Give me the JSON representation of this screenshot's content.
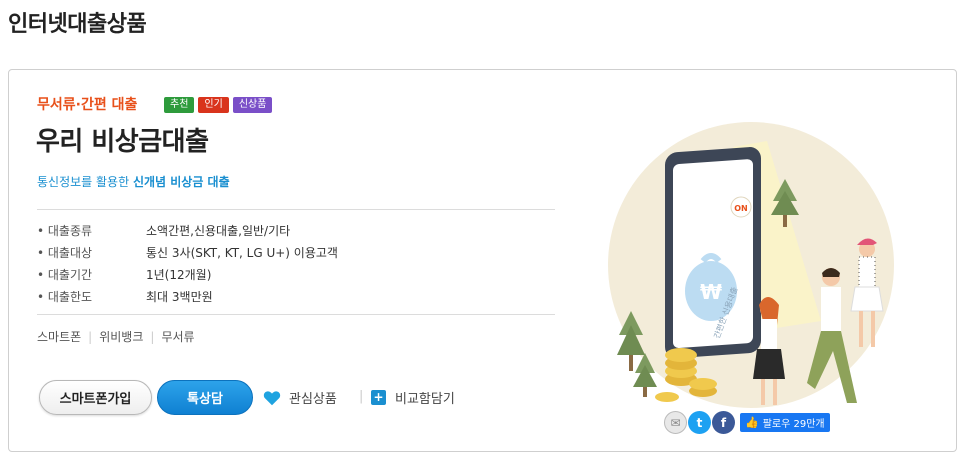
{
  "page": {
    "title": "인터넷대출상품"
  },
  "product": {
    "category": "무서류·간편 대출",
    "badges": [
      {
        "label": "추천",
        "color": "#2e9b3c"
      },
      {
        "label": "인기",
        "color": "#d9341c"
      },
      {
        "label": "신상품",
        "color": "#7a4fc8"
      }
    ],
    "name": "우리 비상금대출",
    "tagline_prefix": "통신정보를 활용한 ",
    "tagline_bold": "신개념 비상금 대출",
    "info": [
      {
        "key": "• 대출종류",
        "value": "소액간편,신용대출,일반/기타"
      },
      {
        "key": "• 대출대상",
        "value": "통신 3사(SKT, KT, LG U+) 이용고객"
      },
      {
        "key": "• 대출기간",
        "value": "1년(12개월)"
      },
      {
        "key": "• 대출한도",
        "value": "최대 3백만원"
      }
    ],
    "tags": [
      "스마트폰",
      "위비뱅크",
      "무서류"
    ]
  },
  "actions": {
    "apply_label": "스마트폰가입",
    "consult_label": "톡상담",
    "favorite_label": "관심상품",
    "favorite_sep": "|",
    "compare_label": "비교함담기"
  },
  "illustration": {
    "phone_badge": "ON",
    "phone_text": "간편한 신용대출",
    "money_symbol": "₩"
  },
  "social": {
    "mail_icon": "mail-icon",
    "twitter_icon": "twitter-icon",
    "facebook_icon": "facebook-icon",
    "follow_label": "팔로우 29만개",
    "colors": {
      "twitter": "#1da1f2",
      "facebook": "#3b5998",
      "follow": "#1877f2"
    }
  },
  "colors": {
    "accent_orange": "#e8501a",
    "accent_blue": "#1a8fd0",
    "consult_button": "#1591db"
  }
}
